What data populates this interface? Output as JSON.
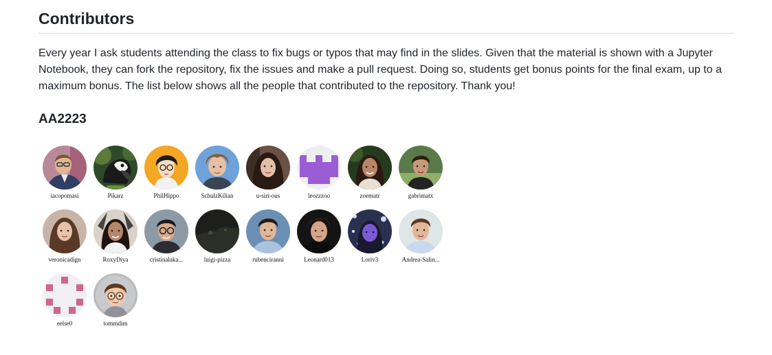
{
  "header": {
    "title": "Contributors",
    "intro": "Every year I ask students attending the class to fix bugs or typos that may find in the slides. Given that the material is shown with a Jupyter Notebook, they can fork the repository, fix the issues and make a pull request. Doing so, students get bonus points for the final exam, up to a maximum bonus. The list below shows all the people that contributed to the repository. Thank you!"
  },
  "year": {
    "label": "AA2223"
  },
  "contributors": [
    {
      "handle": "iacopomasi"
    },
    {
      "handle": "Pikarz"
    },
    {
      "handle": "PhilHippo"
    },
    {
      "handle": "SchulzKilian"
    },
    {
      "handle": "u-siri-ous"
    },
    {
      "handle": "leozzzoo"
    },
    {
      "handle": "zoematr"
    },
    {
      "handle": "gabrimatx"
    },
    {
      "handle": "veronicadign"
    },
    {
      "handle": "RoxyDiya"
    },
    {
      "handle": "cristinalaka..."
    },
    {
      "handle": "luigi-pizza"
    },
    {
      "handle": "rubenciranni"
    },
    {
      "handle": "Leonard013"
    },
    {
      "handle": "Loriv3"
    },
    {
      "handle": "Andrea-Salin..."
    },
    {
      "handle": "eelse0"
    },
    {
      "handle": "tommdim"
    }
  ]
}
